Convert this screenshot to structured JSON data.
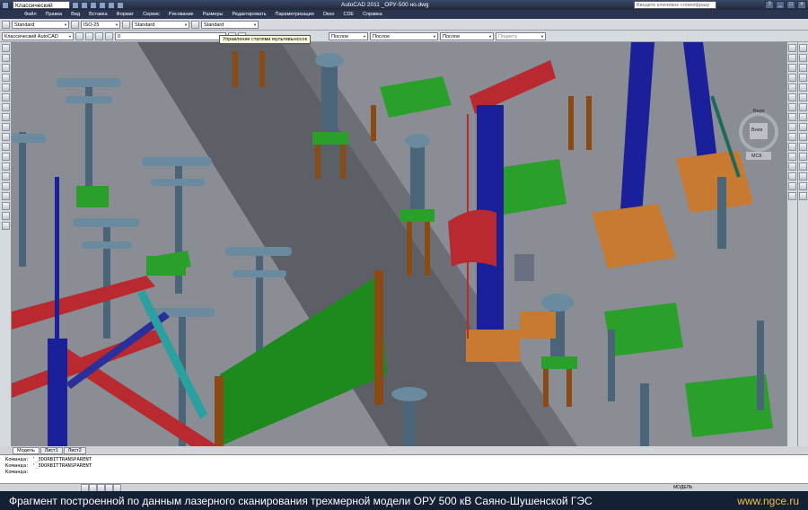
{
  "titlebar": {
    "workspace": "Классический AutoCAD",
    "app_title": "AutoCAD 2011   _ОРУ-500 но.dwg",
    "search_placeholder": "Введите ключевое слово/фразу"
  },
  "menu": {
    "items": [
      "Файл",
      "Правка",
      "Вид",
      "Вставка",
      "Формат",
      "Сервис",
      "Рисование",
      "Размеры",
      "Редактировать",
      "Параметризация",
      "Окно",
      "CDE",
      "Справка"
    ]
  },
  "toolbar1": {
    "text_style": "Standard",
    "dim_style": "ISO-25",
    "table_style": "Standard",
    "mleader_style": "Standard"
  },
  "toolbar2": {
    "workspace": "Классический AutoCAD",
    "layer": "0",
    "color": "Послое",
    "linetype": "Послое",
    "lineweight": "Послое",
    "plotstyle": "Поцвету"
  },
  "tooltip": {
    "text": "Управление стилями мультивыносок"
  },
  "navcube": {
    "top_label": "Верх",
    "side_label": "Вниз",
    "bottom_label": "МСК"
  },
  "tabs": [
    "Модель",
    "Лист1",
    "Лист2"
  ],
  "command_lines": [
    "Команда: '_3DORBITTRANSPARENT",
    "Команда: '_3DORBITTRANSPARENT",
    "Команда:"
  ],
  "statusbar": {
    "model_label": "МОДЕЛЬ"
  },
  "caption": {
    "text": "Фрагмент построенной по данным лазерного сканирования трехмерной модели ОРУ 500 кВ Саяно-Шушенской ГЭС",
    "site": "www.ngce.ru"
  },
  "colors": {
    "ground": "#8a8d93",
    "road": "#5a5d63",
    "steel_blue": "#1a1f9a",
    "equipment": "#4a6478",
    "foundation_green": "#2aa02a",
    "wood_brown": "#8b4a14",
    "red_beam": "#b82a30",
    "teal": "#2aa0a0",
    "base_orange": "#c87a30"
  }
}
